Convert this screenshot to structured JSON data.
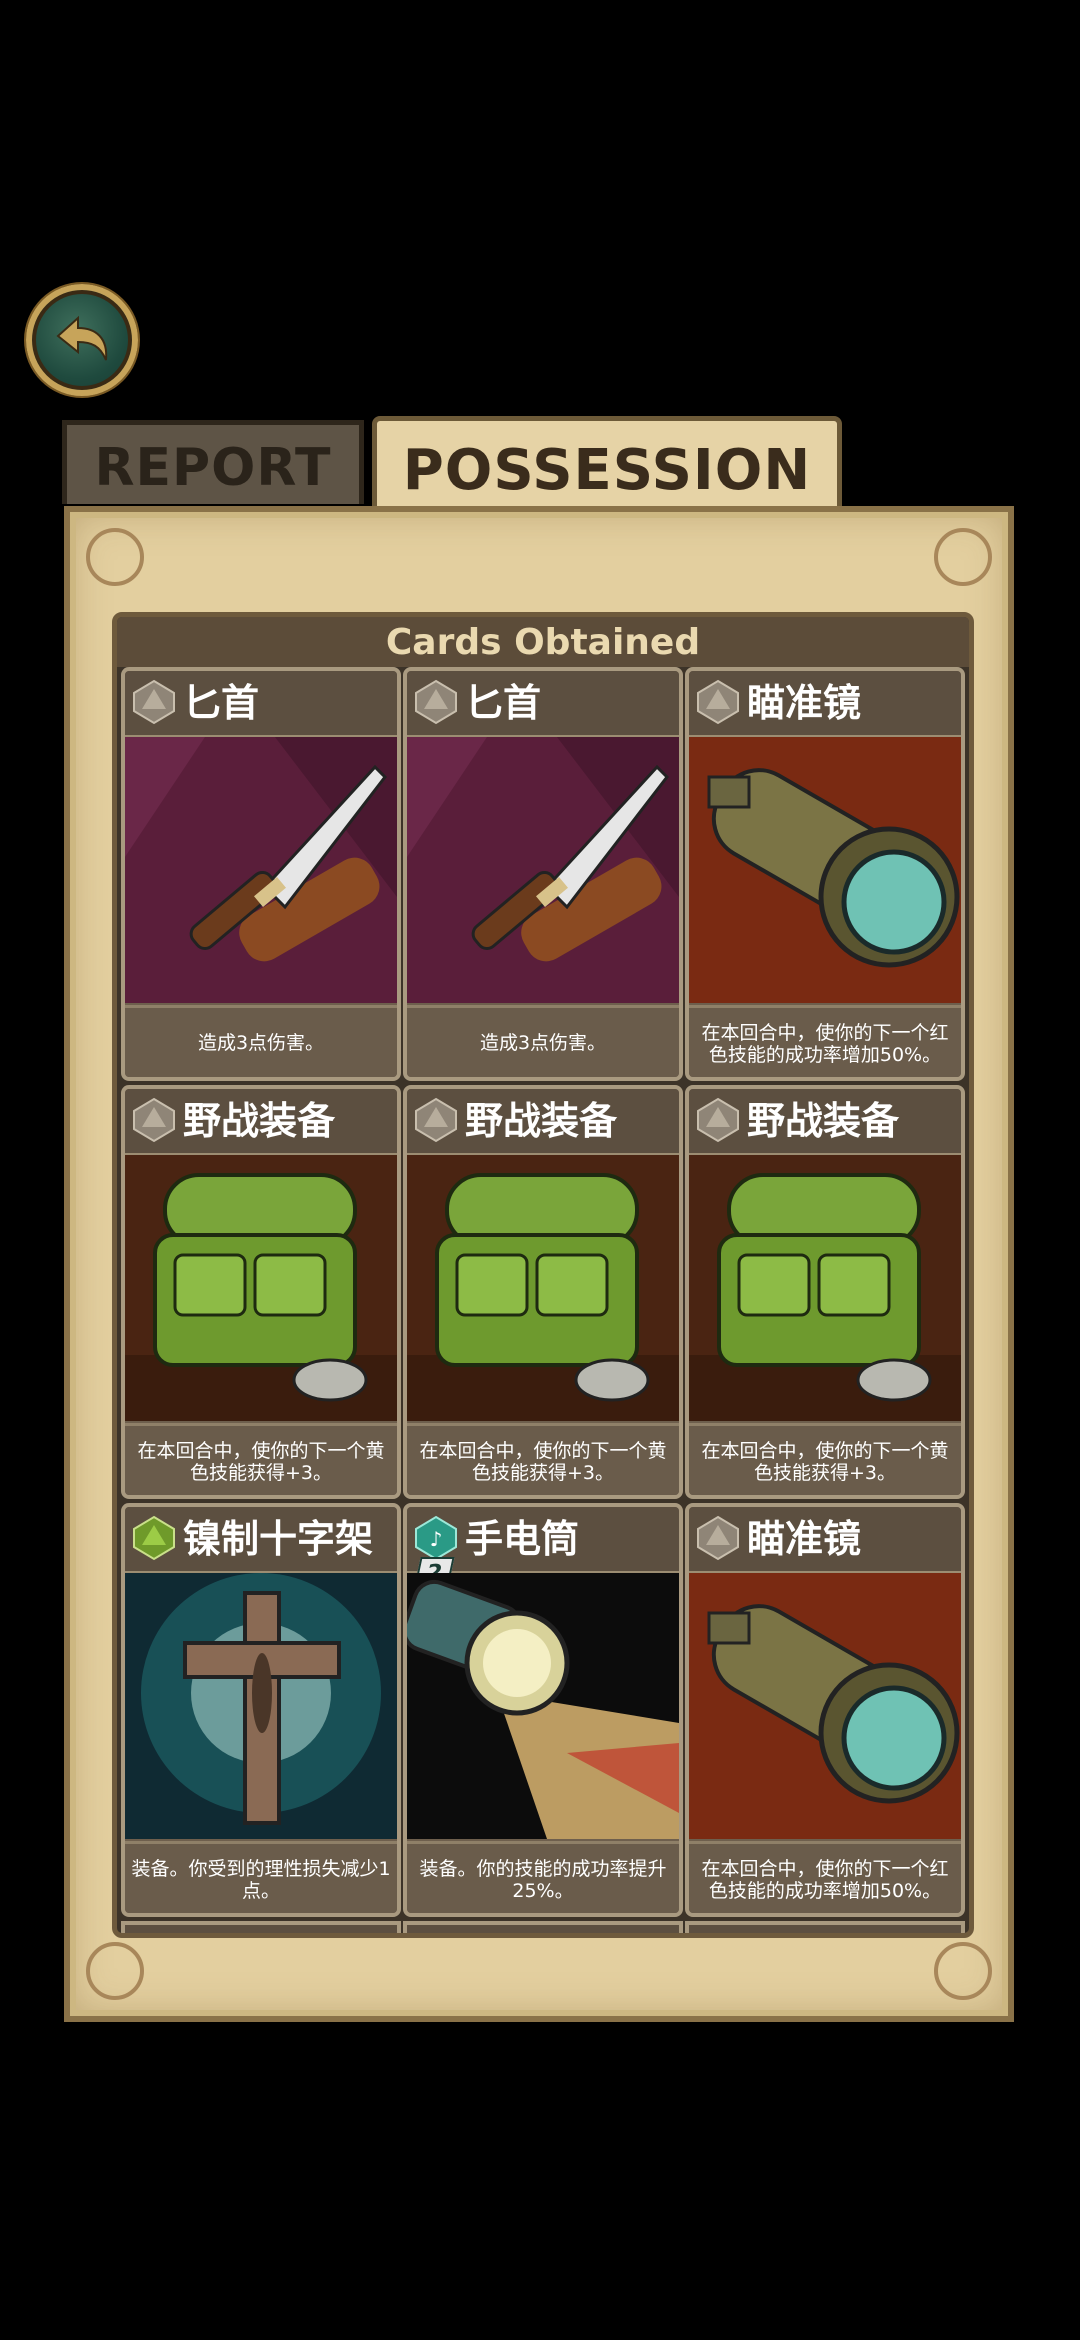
{
  "tabs": [
    {
      "label": "REPORT",
      "active": false
    },
    {
      "label": "POSSESSION",
      "active": true
    }
  ],
  "section": {
    "title": "Cards Obtained"
  },
  "cards": [
    {
      "title": "匕首",
      "desc": "造成3点伤害。",
      "gem": "gray-d20",
      "art": "knife"
    },
    {
      "title": "匕首",
      "desc": "造成3点伤害。",
      "gem": "gray-d20",
      "art": "knife"
    },
    {
      "title": "瞄准镜",
      "desc": "在本回合中，使你的下一个红色技能的成功率增加50%。",
      "gem": "gray-d20",
      "art": "scope"
    },
    {
      "title": "野战装备",
      "desc": "在本回合中，使你的下一个黄色技能获得+3。",
      "gem": "gray-d20",
      "art": "backpack"
    },
    {
      "title": "野战装备",
      "desc": "在本回合中，使你的下一个黄色技能获得+3。",
      "gem": "gray-d20",
      "art": "backpack"
    },
    {
      "title": "野战装备",
      "desc": "在本回合中，使你的下一个黄色技能获得+3。",
      "gem": "gray-d20",
      "art": "backpack"
    },
    {
      "title": "镍制十字架",
      "desc": "装备。你受到的理性损失减少1点。",
      "gem": "green-d20",
      "art": "cross"
    },
    {
      "title": "手电筒",
      "desc": "装备。你的技能的成功率提升25%。",
      "gem": "teal-d20",
      "cost": "2",
      "art": "flashlight"
    },
    {
      "title": "瞄准镜",
      "desc": "在本回合中，使你的下一个红色技能的成功率增加50%。",
      "gem": "gray-d20",
      "art": "scope"
    }
  ],
  "icons": {
    "back": "back-arrow-icon"
  },
  "colors": {
    "panel": "#e3cf9f",
    "frame": "#3c3328",
    "accent": "#c7a45a"
  }
}
